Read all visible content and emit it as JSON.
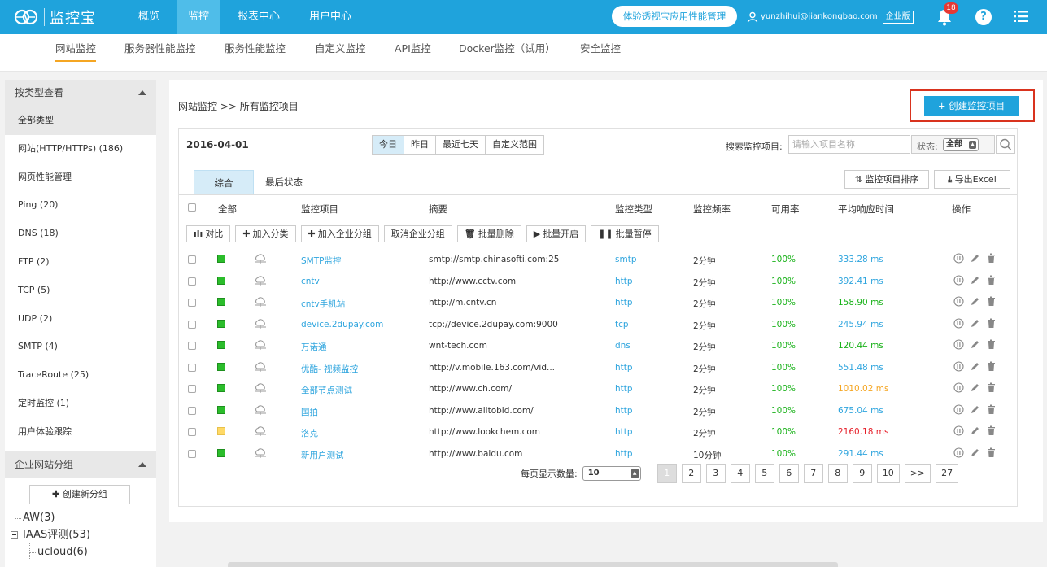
{
  "topbar": {
    "app_name": "监控宝",
    "nav": [
      {
        "label": "概览"
      },
      {
        "label": "监控"
      },
      {
        "label": "报表中心"
      },
      {
        "label": "用户中心"
      }
    ],
    "experience_button": "体验透视宝应用性能管理",
    "user_email": "yunzhihui@jiankongbao.com",
    "edition_badge": "企业版",
    "notification_count": "18",
    "help_label": "?"
  },
  "subnav": [
    {
      "label": "网站监控"
    },
    {
      "label": "服务器性能监控"
    },
    {
      "label": "服务性能监控"
    },
    {
      "label": "自定义监控"
    },
    {
      "label": "API监控"
    },
    {
      "label": "Docker监控（试用）"
    },
    {
      "label": "安全监控"
    }
  ],
  "sidebar": {
    "type_header": "按类型查看",
    "types": [
      {
        "label": "全部类型"
      },
      {
        "label": "网站(HTTP/HTTPs) (186)"
      },
      {
        "label": "网页性能管理"
      },
      {
        "label": "Ping (20)"
      },
      {
        "label": "DNS (18)"
      },
      {
        "label": "FTP (2)"
      },
      {
        "label": "TCP (5)"
      },
      {
        "label": "UDP (2)"
      },
      {
        "label": "SMTP (4)"
      },
      {
        "label": "TraceRoute (25)"
      },
      {
        "label": "定时监控 (1)"
      },
      {
        "label": "用户体验跟踪"
      }
    ],
    "group_header": "企业网站分组",
    "new_group_button": "创建新分组",
    "tree": [
      {
        "label": "AW(3)"
      },
      {
        "label": "IAAS评测(53)"
      },
      {
        "label": "ucloud(6)"
      }
    ]
  },
  "main": {
    "breadcrumb": "网站监控 >> 所有监控项目",
    "create_button": "创建监控项目",
    "date": "2016-04-01",
    "ranges": [
      {
        "label": "今日"
      },
      {
        "label": "昨日"
      },
      {
        "label": "最近七天"
      },
      {
        "label": "自定义范围"
      }
    ],
    "search_label": "搜索监控项目:",
    "search_placeholder": "请输入项目名称",
    "state_label": "状态:",
    "state_value": "全部",
    "tabs": [
      {
        "label": "综合"
      },
      {
        "label": "最后状态"
      }
    ],
    "sort_button": "监控项目排序",
    "excel_button": "导出Excel",
    "columns": {
      "all": "全部",
      "item": "监控项目",
      "summary": "摘要",
      "type": "监控类型",
      "freq": "监控频率",
      "avail": "可用率",
      "resp": "平均响应时间",
      "ops": "操作"
    },
    "toolbar": [
      {
        "label": "对比",
        "icon": "bar-chart-icon"
      },
      {
        "label": "加入分类",
        "icon": "plus-icon"
      },
      {
        "label": "加入企业分组",
        "icon": "plus-icon"
      },
      {
        "label": "取消企业分组",
        "icon": ""
      },
      {
        "label": "批量删除",
        "icon": "trash-icon"
      },
      {
        "label": "批量开启",
        "icon": "play-icon"
      },
      {
        "label": "批量暂停",
        "icon": "pause-icon"
      }
    ],
    "rows": [
      {
        "name": "SMTP监控",
        "summary": "smtp://smtp.chinasofti.com:25",
        "type": "smtp",
        "freq": "2分钟",
        "avail": "100%",
        "resp": "333.28 ms",
        "status": "green",
        "resp_level": "normal"
      },
      {
        "name": "cntv",
        "summary": "http://www.cctv.com",
        "type": "http",
        "freq": "2分钟",
        "avail": "100%",
        "resp": "392.41 ms",
        "status": "green",
        "resp_level": "normal"
      },
      {
        "name": "cntv手机站",
        "summary": "http://m.cntv.cn",
        "type": "http",
        "freq": "2分钟",
        "avail": "100%",
        "resp": "158.90 ms",
        "status": "green",
        "resp_level": "good"
      },
      {
        "name": "device.2dupay.com",
        "summary": "tcp://device.2dupay.com:9000",
        "type": "tcp",
        "freq": "2分钟",
        "avail": "100%",
        "resp": "245.94 ms",
        "status": "green",
        "resp_level": "normal"
      },
      {
        "name": "万诺通",
        "summary": "wnt-tech.com",
        "type": "dns",
        "freq": "2分钟",
        "avail": "100%",
        "resp": "120.44 ms",
        "status": "green",
        "resp_level": "good"
      },
      {
        "name": "优酷- 视频监控",
        "summary": "http://v.mobile.163.com/vid...",
        "type": "http",
        "freq": "2分钟",
        "avail": "100%",
        "resp": "551.48 ms",
        "status": "green",
        "resp_level": "normal"
      },
      {
        "name": "全部节点测试",
        "summary": "http://www.ch.com/",
        "type": "http",
        "freq": "2分钟",
        "avail": "100%",
        "resp": "1010.02 ms",
        "status": "green",
        "resp_level": "warn"
      },
      {
        "name": "国拍",
        "summary": "http://www.alltobid.com/",
        "type": "http",
        "freq": "2分钟",
        "avail": "100%",
        "resp": "675.04 ms",
        "status": "green",
        "resp_level": "normal"
      },
      {
        "name": "洛克",
        "summary": "http://www.lookchem.com",
        "type": "http",
        "freq": "2分钟",
        "avail": "100%",
        "resp": "2160.18 ms",
        "status": "yellow",
        "resp_level": "bad"
      },
      {
        "name": "新用户测试",
        "summary": "http://www.baidu.com",
        "type": "http",
        "freq": "10分钟",
        "avail": "100%",
        "resp": "291.44 ms",
        "status": "green",
        "resp_level": "normal"
      }
    ],
    "pager": {
      "per_page_label": "每页显示数量:",
      "per_page_value": "10",
      "pages": [
        "1",
        "2",
        "3",
        "4",
        "5",
        "6",
        "7",
        "8",
        "9",
        "10",
        ">>",
        "27"
      ]
    }
  },
  "colors": {
    "primary": "#1fa3dc",
    "accent": "#f5a623",
    "ok": "#19b219",
    "warn": "#f5a623",
    "bad": "#e6202a",
    "highlight_border": "#d9331e"
  }
}
